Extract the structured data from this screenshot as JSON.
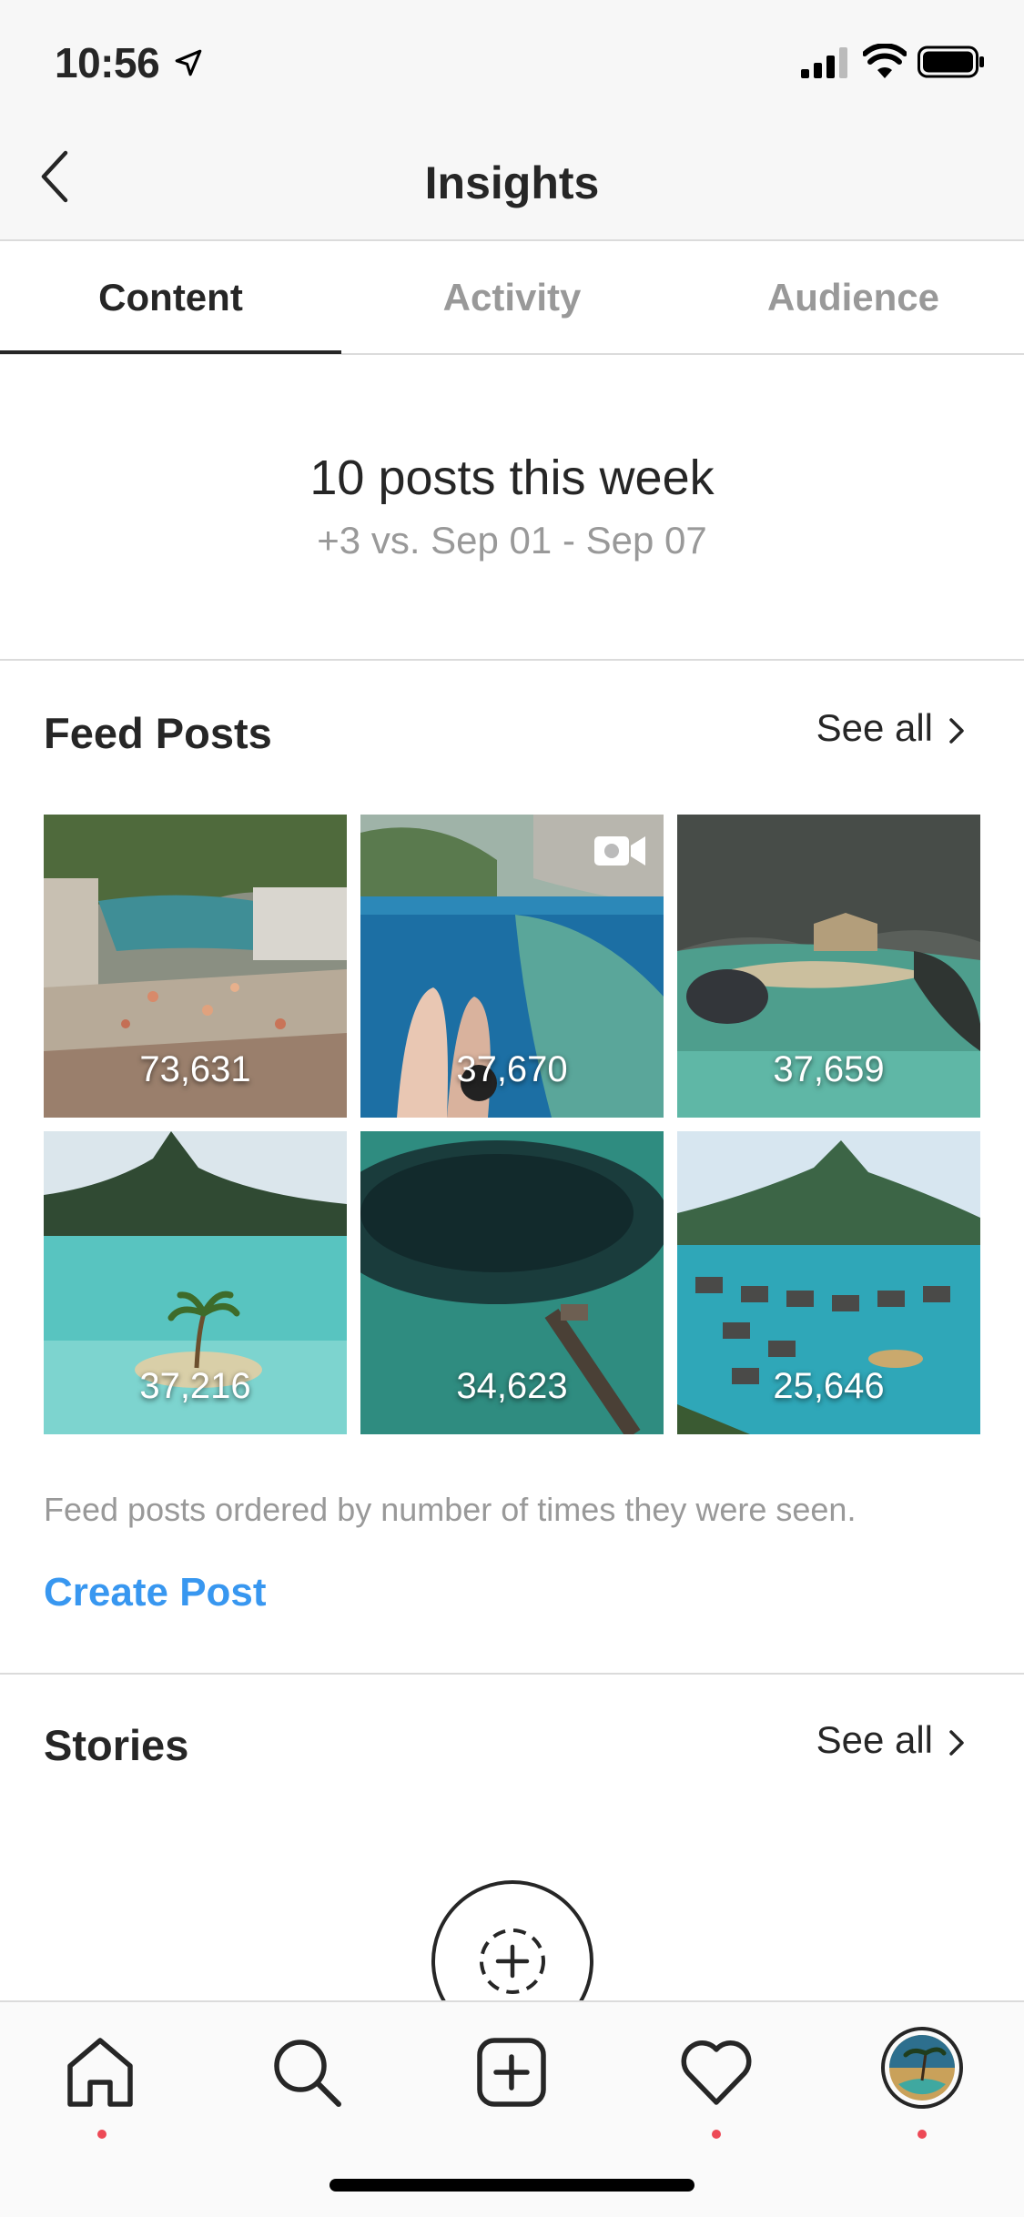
{
  "status_bar": {
    "time": "10:56"
  },
  "nav": {
    "title": "Insights"
  },
  "tabs": [
    {
      "label": "Content",
      "active": true
    },
    {
      "label": "Activity",
      "active": false
    },
    {
      "label": "Audience",
      "active": false
    }
  ],
  "summary": {
    "headline": "10 posts this week",
    "comparison": "+3 vs. Sep 01 - Sep 07"
  },
  "feed_posts": {
    "title": "Feed Posts",
    "see_all": "See all",
    "posts": [
      {
        "count": "73,631",
        "is_video": false
      },
      {
        "count": "37,670",
        "is_video": true
      },
      {
        "count": "37,659",
        "is_video": false
      },
      {
        "count": "37,216",
        "is_video": false
      },
      {
        "count": "34,623",
        "is_video": false
      },
      {
        "count": "25,646",
        "is_video": false
      }
    ],
    "caption": "Feed posts ordered by number of times they were seen.",
    "create_label": "Create Post"
  },
  "stories": {
    "title": "Stories",
    "see_all": "See all"
  },
  "tab_bar": {
    "items": [
      "home-icon",
      "search-icon",
      "new-post-icon",
      "activity-heart-icon",
      "profile-avatar"
    ],
    "notification_color": "#ed4956"
  },
  "colors": {
    "accent": "#3897f0",
    "text": "#262626",
    "muted": "#999999"
  }
}
